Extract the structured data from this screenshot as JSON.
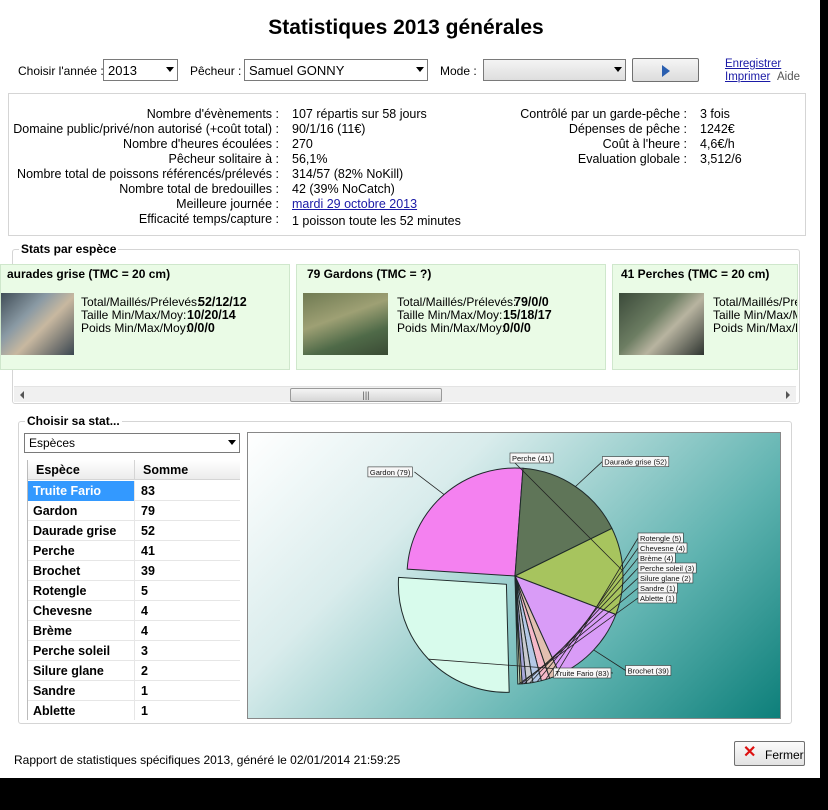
{
  "title": "Statistiques 2013 générales",
  "toolbar": {
    "year_label": "Choisir l'année :",
    "year_value": "2013",
    "fisher_label": "Pêcheur :",
    "fisher_value": "Samuel GONNY",
    "mode_label": "Mode :",
    "mode_value": "",
    "save_link": "Enregistrer",
    "print_link": "Imprimer",
    "help_label": "Aide"
  },
  "summary_left": [
    {
      "label": "Nombre d'évènements :",
      "value": "107 répartis sur 58 jours"
    },
    {
      "label": "Domaine public/privé/non autorisé (+coût total) :",
      "value": "90/1/16  (11€)"
    },
    {
      "label": "Nombre d'heures écoulées :",
      "value": "270"
    },
    {
      "label": "Pêcheur solitaire à :",
      "value": "56,1%"
    },
    {
      "label": "Nombre total de poissons référencés/prélevés :",
      "value": "314/57  (82% NoKill)"
    },
    {
      "label": "Nombre total de bredouilles :",
      "value": "42  (39% NoCatch)"
    },
    {
      "label": "Meilleure journée :",
      "value": "mardi 29 octobre 2013"
    },
    {
      "label": "Efficacité temps/capture :",
      "value": "1 poisson toute les 52 minutes"
    }
  ],
  "summary_right": [
    {
      "label": "Contrôlé par un garde-pêche :",
      "value": "3 fois"
    },
    {
      "label": "Dépenses de pêche :",
      "value": "1242€"
    },
    {
      "label": "Coût à l'heure :",
      "value": "4,6€/h"
    },
    {
      "label": "Evaluation globale :",
      "value": "3,512/6"
    }
  ],
  "species_section_title": "Stats par espèce",
  "species_cards": [
    {
      "title": "aurades grise  (TMC = 20 cm)",
      "l1": "Total/Maillés/Prélevés:",
      "v1": "52/12/12",
      "l2": "Taille Min/Max/Moy:",
      "v2": "10/20/14",
      "l3": "Poids Min/Max/Moy:",
      "v3": "0/0/0"
    },
    {
      "title": "79 Gardons  (TMC = ?)",
      "l1": "Total/Maillés/Prélevés:",
      "v1": "79/0/0",
      "l2": "Taille Min/Max/Moy:",
      "v2": "15/18/17",
      "l3": "Poids Min/Max/Moy:",
      "v3": "0/0/0"
    },
    {
      "title": "41 Perches  (TMC = 20 cm)",
      "l1": "Total/Maillés/Prélé",
      "v1": "",
      "l2": "Taille Min/Max/M",
      "v2": "",
      "l3": "Poids Min/Max/M",
      "v3": ""
    }
  ],
  "stat_section_title": "Choisir sa stat...",
  "stat_combo_value": "Espèces",
  "table": {
    "headers": [
      "Espèce",
      "Somme"
    ],
    "rows": [
      [
        "Truite Fario",
        "83"
      ],
      [
        "Gardon",
        "79"
      ],
      [
        "Daurade grise",
        "52"
      ],
      [
        "Perche",
        "41"
      ],
      [
        "Brochet",
        "39"
      ],
      [
        "Rotengle",
        "5"
      ],
      [
        "Chevesne",
        "4"
      ],
      [
        "Brème",
        "4"
      ],
      [
        "Perche soleil",
        "3"
      ],
      [
        "Silure glane",
        "2"
      ],
      [
        "Sandre",
        "1"
      ],
      [
        "Ablette",
        "1"
      ]
    ]
  },
  "chart_data": {
    "type": "pie",
    "categories": [
      "Truite Fario",
      "Gardon",
      "Daurade grise",
      "Perche",
      "Brochet",
      "Rotengle",
      "Chevesne",
      "Brème",
      "Perche soleil",
      "Silure glane",
      "Sandre",
      "Ablette"
    ],
    "values": [
      83,
      79,
      52,
      41,
      39,
      5,
      4,
      4,
      3,
      2,
      1,
      1
    ],
    "labels": [
      "Truite Fario (83)",
      "Gardon (79)",
      "Daurade grise (52)",
      "Perche (41)",
      "Brochet (39)",
      "Rotengle (5)",
      "Chevesne (4)",
      "Brème (4)",
      "Perche soleil (3)",
      "Silure glane (2)",
      "Sandre (1)",
      "Ablette (1)"
    ],
    "colors": [
      "#d8fbec",
      "#f481f0",
      "#5f7558",
      "#a7c45e",
      "#d99cf7",
      "#e2bfb0",
      "#f5b8c8",
      "#b4c8e6",
      "#c9c9cf",
      "#a8a6d8",
      "#e6d59c",
      "#c0dcc0"
    ],
    "exploded": "Truite Fario"
  },
  "footer": {
    "report_text": "Rapport de statistiques spécifiques  2013, généré le 02/01/2014 21:59:25",
    "close_label": "Fermer"
  }
}
